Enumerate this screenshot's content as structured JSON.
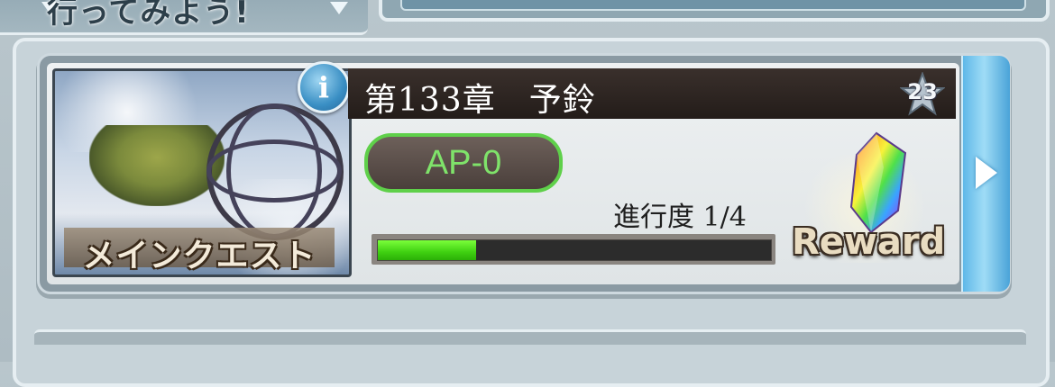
{
  "header": {
    "text": "行ってみよう!"
  },
  "quest": {
    "category_label": "メインクエスト",
    "info_label": "i",
    "title": "第133章　予鈴",
    "star_count": "23",
    "ap_label": "AP-0",
    "progress_label": "進行度 1/4",
    "progress_fraction": 0.25,
    "reward_label": "Reward"
  },
  "colors": {
    "ap_text": "#7fe36a",
    "ap_border": "#5fd04a",
    "progress_fill": "#4fd017",
    "title_bar": "#2a221f",
    "arrow_button": "#6cc0ec"
  },
  "icons": {
    "info": "info-icon",
    "star": "star-icon",
    "next": "chevron-right-icon",
    "reward_item": "rainbow-crystal-icon"
  }
}
